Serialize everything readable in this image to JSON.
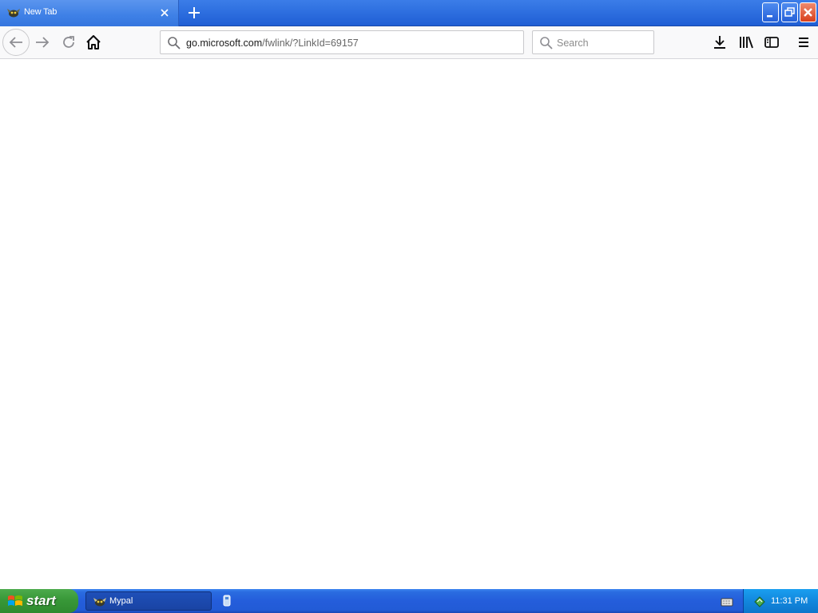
{
  "browser": {
    "tab": {
      "title": "New Tab"
    },
    "urlbar": {
      "scheme_host": "go.microsoft.com",
      "path": "/fwlink/?LinkId=69157"
    },
    "searchbar": {
      "placeholder": "Search"
    },
    "icons": [
      "tab-favicon-icon",
      "tab-close-icon",
      "new-tab-icon",
      "back-icon",
      "forward-icon",
      "reload-icon",
      "home-icon",
      "search-icon",
      "download-icon",
      "library-icon",
      "sidebar-icon",
      "menu-icon"
    ]
  },
  "window_controls": [
    "minimize",
    "restore",
    "close"
  ],
  "taskbar": {
    "start_label": "start",
    "task_item": {
      "label": "Mypal"
    },
    "clock": "11:31 PM"
  },
  "colors": {
    "titlebar": "#2e6fe0",
    "taskbar": "#245ddb",
    "start_button": "#389838",
    "tray": "#1287dd",
    "close_button": "#d8401c"
  }
}
